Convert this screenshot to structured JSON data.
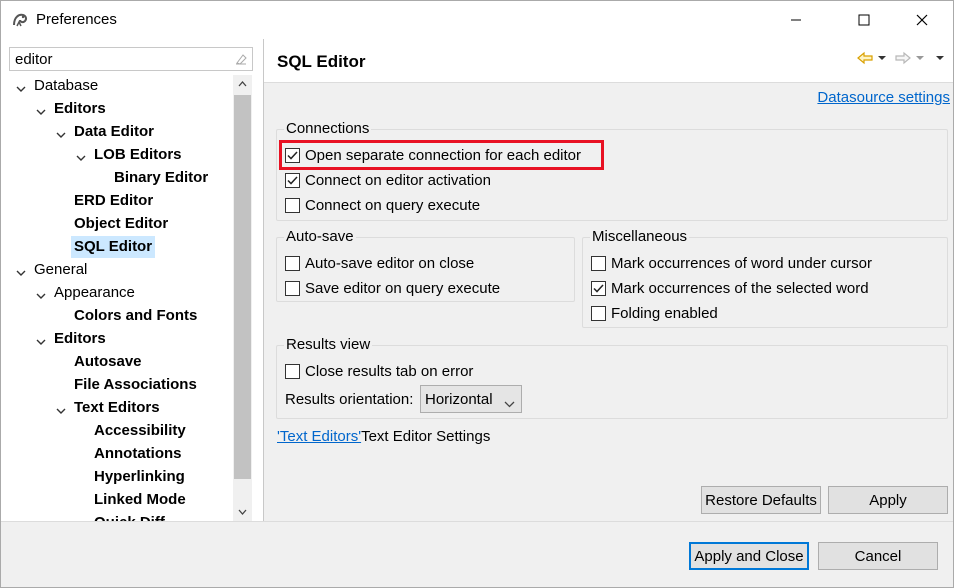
{
  "window": {
    "title": "Preferences"
  },
  "filter": {
    "value": "editor"
  },
  "tree": [
    {
      "label": "Database",
      "bold": false,
      "depth": 0,
      "expanded": true
    },
    {
      "label": "Editors",
      "bold": true,
      "depth": 1,
      "expanded": true
    },
    {
      "label": "Data Editor",
      "bold": true,
      "depth": 2,
      "expanded": true
    },
    {
      "label": "LOB Editors",
      "bold": true,
      "depth": 3,
      "expanded": true
    },
    {
      "label": "Binary Editor",
      "bold": true,
      "depth": 4,
      "expanded": null
    },
    {
      "label": "ERD Editor",
      "bold": true,
      "depth": 2,
      "expanded": null
    },
    {
      "label": "Object Editor",
      "bold": true,
      "depth": 2,
      "expanded": null
    },
    {
      "label": "SQL Editor",
      "bold": true,
      "depth": 2,
      "expanded": null,
      "selected": true
    },
    {
      "label": "General",
      "bold": false,
      "depth": 0,
      "expanded": true
    },
    {
      "label": "Appearance",
      "bold": false,
      "depth": 1,
      "expanded": true
    },
    {
      "label": "Colors and Fonts",
      "bold": true,
      "depth": 2,
      "expanded": null
    },
    {
      "label": "Editors",
      "bold": true,
      "depth": 1,
      "expanded": true
    },
    {
      "label": "Autosave",
      "bold": true,
      "depth": 2,
      "expanded": null
    },
    {
      "label": "File Associations",
      "bold": true,
      "depth": 2,
      "expanded": null
    },
    {
      "label": "Text Editors",
      "bold": true,
      "depth": 2,
      "expanded": true
    },
    {
      "label": "Accessibility",
      "bold": true,
      "depth": 3,
      "expanded": null
    },
    {
      "label": "Annotations",
      "bold": true,
      "depth": 3,
      "expanded": null
    },
    {
      "label": "Hyperlinking",
      "bold": true,
      "depth": 3,
      "expanded": null
    },
    {
      "label": "Linked Mode",
      "bold": true,
      "depth": 3,
      "expanded": null
    },
    {
      "label": "Quick Diff",
      "bold": true,
      "depth": 3,
      "expanded": null
    }
  ],
  "page": {
    "title": "SQL Editor",
    "datasource_link": "Datasource settings",
    "connections": {
      "title": "Connections",
      "items": [
        {
          "label": "Open separate connection for each editor",
          "checked": true
        },
        {
          "label": "Connect on editor activation",
          "checked": true
        },
        {
          "label": "Connect on query execute",
          "checked": false
        }
      ]
    },
    "autosave": {
      "title": "Auto-save",
      "items": [
        {
          "label": "Auto-save editor on close",
          "checked": false
        },
        {
          "label": "Save editor on query execute",
          "checked": false
        }
      ]
    },
    "misc": {
      "title": "Miscellaneous",
      "items": [
        {
          "label": "Mark occurrences of word under cursor",
          "checked": false
        },
        {
          "label": "Mark occurrences of the selected word",
          "checked": true
        },
        {
          "label": "Folding enabled",
          "checked": false
        }
      ]
    },
    "results": {
      "title": "Results view",
      "close_tab_label": "Close results tab on error",
      "close_tab_checked": false,
      "orientation_label": "Results orientation:",
      "orientation_value": "Horizontal"
    },
    "text_editors_link": "'Text Editors'",
    "text_editors_suffix": "Text Editor Settings",
    "restore_defaults": "Restore Defaults",
    "apply": "Apply"
  },
  "footer": {
    "apply_close": "Apply and Close",
    "cancel": "Cancel"
  },
  "colors": {
    "highlight": "#e81123",
    "link": "#0066cc",
    "selection": "#cce8ff",
    "nav_arrow": "#d9a000"
  }
}
